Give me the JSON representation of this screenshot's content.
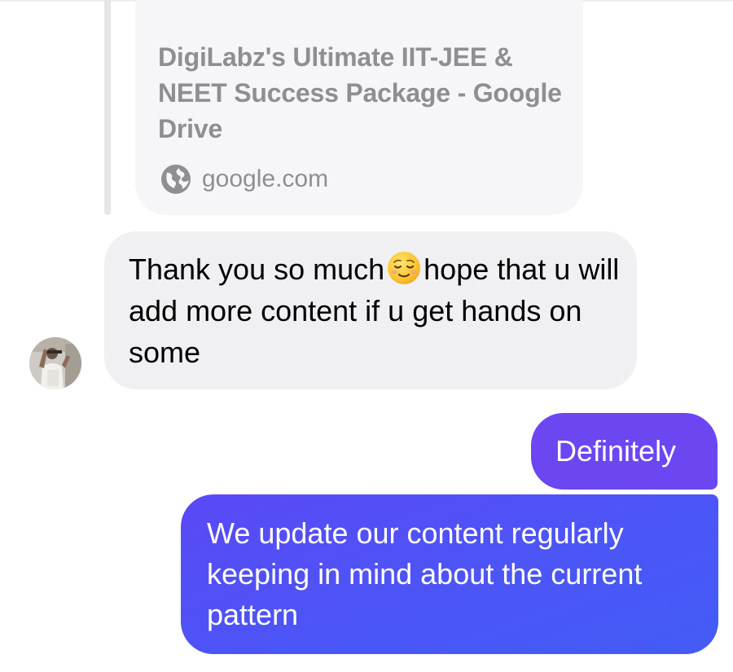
{
  "link_preview": {
    "title": "DigiLabz's Ultimate IIT-JEE & NEET Success Package - Google Drive",
    "domain": "google.com",
    "icon": "globe-icon"
  },
  "incoming_message": {
    "text_before_emoji": "Thank you so much",
    "emoji": "relieved-face-emoji",
    "text_after_emoji": "hope that u will add more content if u get hands on some"
  },
  "sender": {
    "avatar": "avatar"
  },
  "outgoing_messages": [
    {
      "text": "Definitely"
    },
    {
      "text": "We update our content regularly keeping in mind about the current pattern"
    }
  ],
  "colors": {
    "incoming_bubble": "#f0f0f2",
    "link_card": "#f6f6f8",
    "outgoing_short": "#6b46f1",
    "outgoing_long": "#4c55f6",
    "secondary_text": "#8e8e93"
  }
}
